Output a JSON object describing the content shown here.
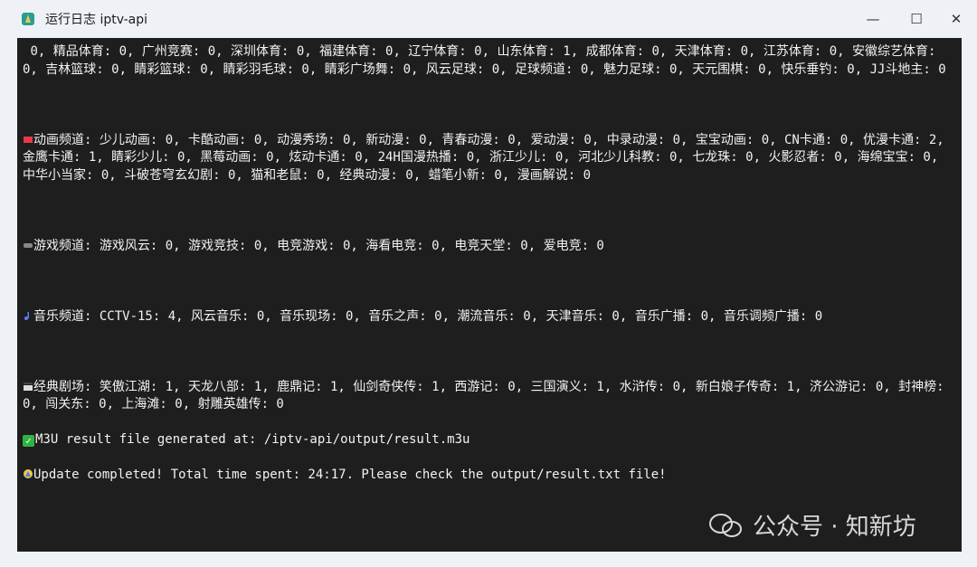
{
  "window": {
    "title": "运行日志 iptv-api",
    "controls": {
      "minimize": "—",
      "maximize": "☐",
      "close": "✕"
    }
  },
  "console": {
    "lines": [
      " 0, 精品体育: 0, 广州竞赛: 0, 深圳体育: 0, 福建体育: 0, 辽宁体育: 0, 山东体育: 1, 成都体育: 0, 天津体育: 0, 江苏体育: 0, 安徽综艺体育: 0, 吉林篮球: 0, 睛彩篮球: 0, 睛彩羽毛球: 0, 睛彩广场舞: 0, 风云足球: 0, 足球频道: 0, 魅力足球: 0, 天元围棋: 0, 快乐垂钓: 0, JJ斗地主: 0",
      "动画频道: 少儿动画: 0, 卡酷动画: 0, 动漫秀场: 0, 新动漫: 0, 青春动漫: 0, 爱动漫: 0, 中录动漫: 0, 宝宝动画: 0, CN卡通: 0, 优漫卡通: 2, 金鹰卡通: 1, 睛彩少儿: 0, 黑莓动画: 0, 炫动卡通: 0, 24H国漫热播: 0, 浙江少儿: 0, 河北少儿科教: 0, 七龙珠: 0, 火影忍者: 0, 海绵宝宝: 0, 中华小当家: 0, 斗破苍穹玄幻剧: 0, 猫和老鼠: 0, 经典动漫: 0, 蜡笔小新: 0, 漫画解说: 0",
      "游戏频道: 游戏风云: 0, 游戏竞技: 0, 电竞游戏: 0, 海看电竞: 0, 电竞天堂: 0, 爱电竞: 0",
      "音乐频道: CCTV-15: 4, 风云音乐: 0, 音乐现场: 0, 音乐之声: 0, 潮流音乐: 0, 天津音乐: 0, 音乐广播: 0, 音乐调频广播: 0",
      "经典剧场: 笑傲江湖: 1, 天龙八部: 1, 鹿鼎记: 1, 仙剑奇侠传: 1, 西游记: 0, 三国演义: 1, 水浒传: 0, 新白娘子传奇: 1, 济公游记: 0, 封神榜: 0, 闯关东: 0, 上海滩: 0, 射雕英雄传: 0",
      "M3U result file generated at: /iptv-api/output/result.m3u",
      "Update completed! Total time spent: 24:17. Please check the output/result.txt file!"
    ],
    "icons": [
      "tv-icon",
      "gamepad-icon",
      "music-note-icon",
      "theater-icon",
      "check-icon",
      "party-icon"
    ]
  },
  "watermark": {
    "text": "公众号 · 知新坊"
  },
  "colors": {
    "console_bg": "#1e1e1e",
    "console_text": "#f2f2f2",
    "check": "#2fb344"
  }
}
